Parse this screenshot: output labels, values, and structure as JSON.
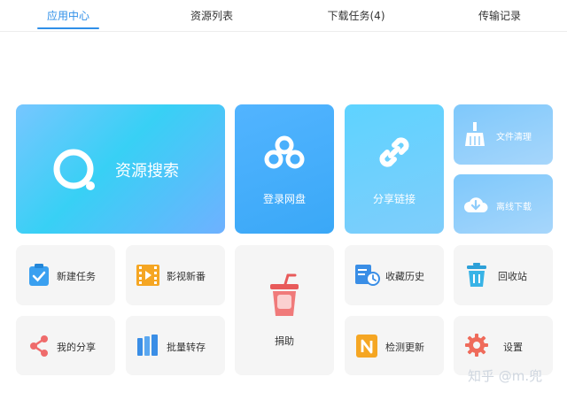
{
  "tabs": [
    {
      "label": "应用中心",
      "active": true
    },
    {
      "label": "资源列表",
      "active": false
    },
    {
      "label": "下载任务(4)",
      "active": false
    },
    {
      "label": "传输记录",
      "active": false
    }
  ],
  "tiles": {
    "search": {
      "label": "资源搜索",
      "icon": "search-icon"
    },
    "login_pan": {
      "label": "登录网盘",
      "icon": "baidu-cloud-icon"
    },
    "share_link": {
      "label": "分享链接",
      "icon": "link-icon"
    },
    "file_clean": {
      "label": "文件清理",
      "icon": "broom-icon"
    },
    "offline_download": {
      "label": "离线下载",
      "icon": "cloud-download-icon"
    },
    "new_task": {
      "label": "新建任务",
      "icon": "clipboard-check-icon"
    },
    "video_new": {
      "label": "影视新番",
      "icon": "film-icon"
    },
    "donate": {
      "label": "捐助",
      "icon": "cup-icon"
    },
    "favorites": {
      "label": "收藏历史",
      "icon": "history-icon"
    },
    "recycle": {
      "label": "回收站",
      "icon": "trash-icon"
    },
    "my_share": {
      "label": "我的分享",
      "icon": "share-icon"
    },
    "batch_save": {
      "label": "批量转存",
      "icon": "batch-icon"
    },
    "check_update": {
      "label": "检测更新",
      "icon": "update-icon"
    },
    "settings": {
      "label": "设置",
      "icon": "gear-icon"
    }
  },
  "watermark": "知乎 @m.兜",
  "colors": {
    "accent": "#2f8fe8",
    "tile_gray": "#f5f5f5"
  }
}
